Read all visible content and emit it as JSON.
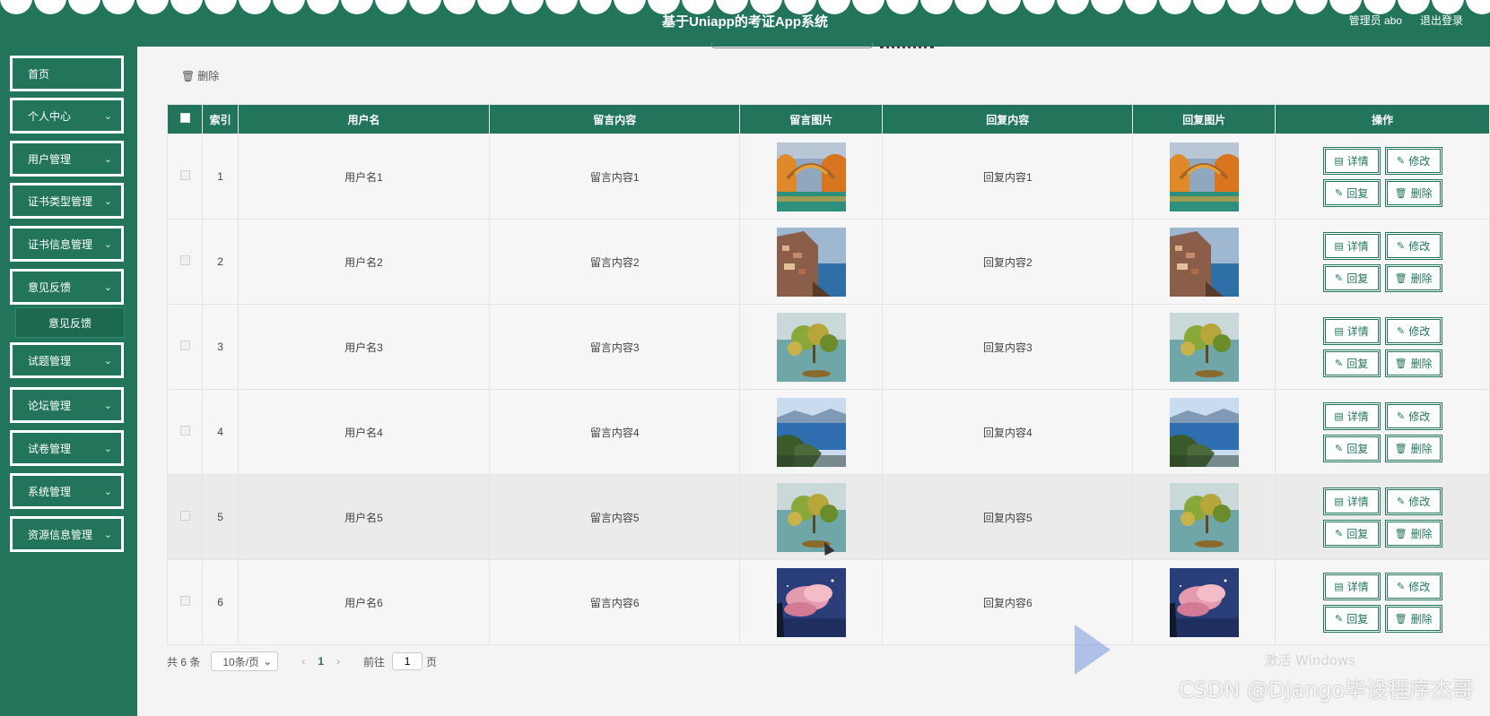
{
  "header": {
    "title": "基于Uniapp的考证App系统",
    "user_label": "管理员 abo",
    "logout_label": "退出登录"
  },
  "sidebar": {
    "items": [
      {
        "label": "首页",
        "has_chevron": false
      },
      {
        "label": "个人中心",
        "has_chevron": true
      },
      {
        "label": "用户管理",
        "has_chevron": true
      },
      {
        "label": "证书类型管理",
        "has_chevron": true
      },
      {
        "label": "证书信息管理",
        "has_chevron": true
      },
      {
        "label": "意见反馈",
        "has_chevron": true
      },
      {
        "label": "试题管理",
        "has_chevron": true
      },
      {
        "label": "论坛管理",
        "has_chevron": true
      },
      {
        "label": "试卷管理",
        "has_chevron": true
      },
      {
        "label": "系统管理",
        "has_chevron": true
      },
      {
        "label": "资源信息管理",
        "has_chevron": true
      }
    ],
    "sub_item": "意见反馈"
  },
  "toolbar": {
    "delete_label": "删除"
  },
  "table": {
    "headers": [
      "索引",
      "用户名",
      "留言内容",
      "留言图片",
      "回复内容",
      "回复图片",
      "操作"
    ],
    "rows": [
      {
        "index": "1",
        "username": "用户名1",
        "message": "留言内容1",
        "reply": "回复内容1",
        "image": "autumn-bridge"
      },
      {
        "index": "2",
        "username": "用户名2",
        "message": "留言内容2",
        "reply": "回复内容2",
        "image": "cliff-village"
      },
      {
        "index": "3",
        "username": "用户名3",
        "message": "留言内容3",
        "reply": "回复内容3",
        "image": "lake-trees"
      },
      {
        "index": "4",
        "username": "用户名4",
        "message": "留言内容4",
        "reply": "回复内容4",
        "image": "blue-lake"
      },
      {
        "index": "5",
        "username": "用户名5",
        "message": "留言内容5",
        "reply": "回复内容5",
        "image": "lake-trees"
      },
      {
        "index": "6",
        "username": "用户名6",
        "message": "留言内容6",
        "reply": "回复内容6",
        "image": "pink-clouds"
      }
    ],
    "actions": {
      "detail": "详情",
      "edit": "修改",
      "reply": "回复",
      "delete": "删除"
    }
  },
  "pagination": {
    "total": "共 6 条",
    "page_size": "10条/页",
    "current_page": "1",
    "goto_label": "前往",
    "goto_value": "1",
    "page_suffix": "页"
  },
  "watermark": {
    "main": "CSDN @Django毕设程序杰哥",
    "overlay": "激活 Windows"
  },
  "colors": {
    "primary": "#22755b",
    "background": "#f4f4f4"
  }
}
